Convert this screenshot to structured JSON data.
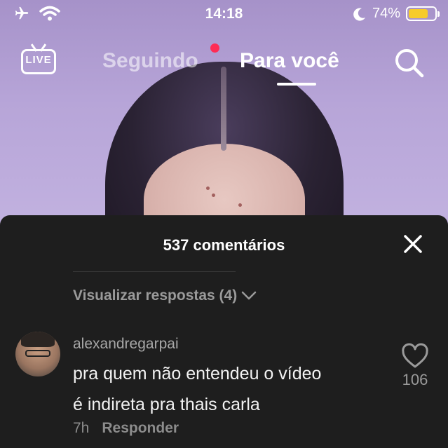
{
  "status_bar": {
    "time": "14:18",
    "battery_percent": "74%",
    "battery_level": 0.74
  },
  "topnav": {
    "live_label": "LIVE",
    "tab_following": "Seguindo",
    "tab_for_you": "Para você",
    "active_tab": "Para você"
  },
  "comments": {
    "title": "537 comentários",
    "view_replies": "Visualizar respostas (4)",
    "items": [
      {
        "username": "alexandregarpai",
        "text_line1": "pra quem não entendeu o vídeo",
        "text_line2": "é indireta pra thais carla",
        "time": "7h",
        "reply_label": "Responder",
        "likes": "106"
      }
    ]
  },
  "colors": {
    "accent_red": "#fe2c55",
    "battery_yellow": "#f7cc2b",
    "sheet_bg": "#1e1e1e"
  },
  "icons": [
    "airplane-icon",
    "wifi-icon",
    "moon-icon",
    "battery-icon",
    "live-icon",
    "search-icon",
    "close-icon",
    "chevron-down-icon",
    "heart-icon"
  ]
}
